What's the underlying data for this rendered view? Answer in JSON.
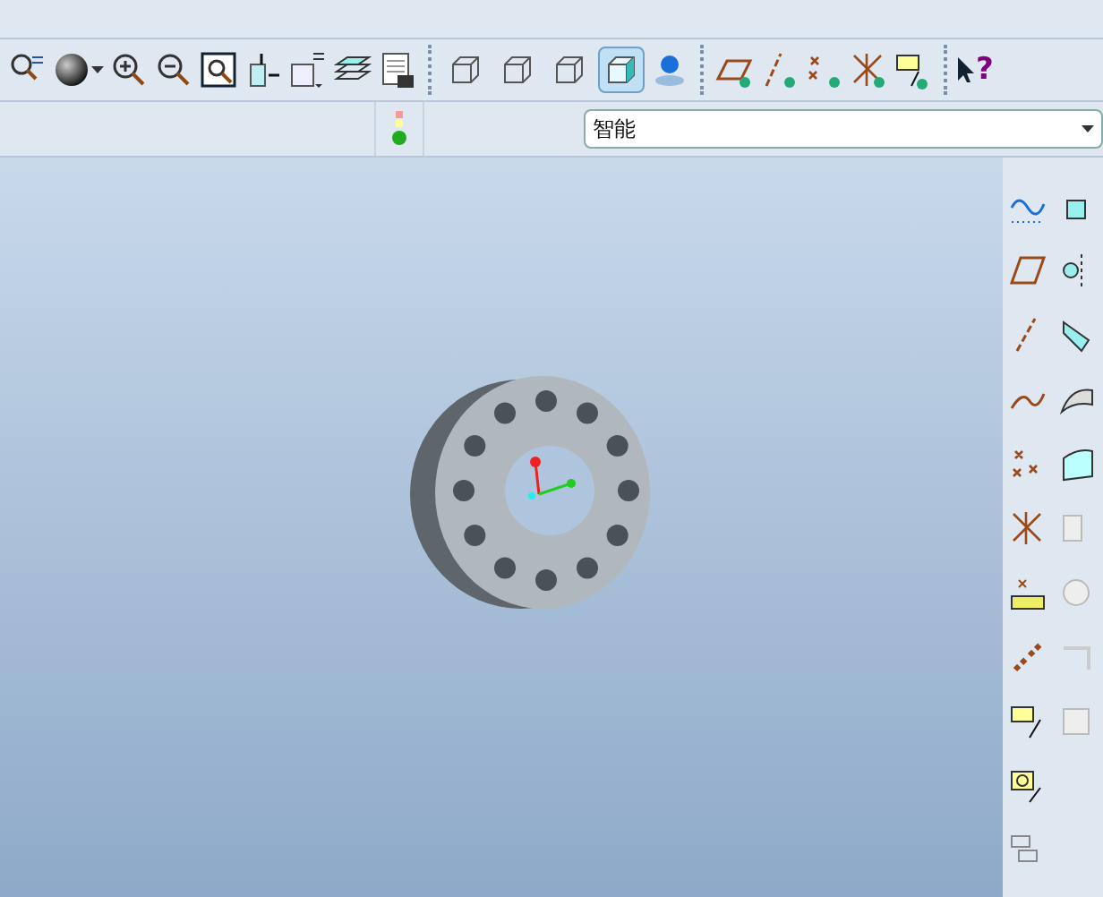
{
  "display_styles": [
    {
      "selected": false
    },
    {
      "selected": false
    },
    {
      "selected": false
    },
    {
      "selected": true
    }
  ],
  "help_button": {
    "label": "?"
  },
  "filter": {
    "value": "智能"
  }
}
